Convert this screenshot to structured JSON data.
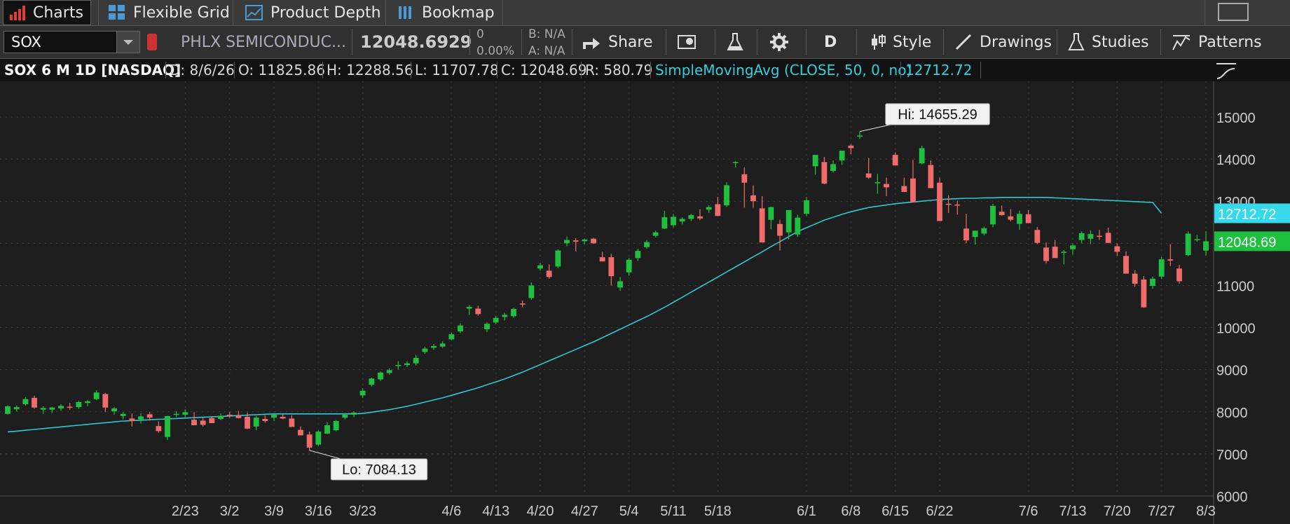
{
  "tabs": [
    {
      "label": "Charts",
      "icon": "bar-chart-icon"
    },
    {
      "label": "Flexible Grid",
      "icon": "grid-icon"
    },
    {
      "label": "Product Depth",
      "icon": "depth-chart-icon"
    },
    {
      "label": "Bookmap",
      "icon": "bookmap-icon"
    }
  ],
  "toolbar": {
    "symbol": "SOX",
    "description": "PHLX SEMICONDUC...",
    "last": "12048.6929",
    "change": "0",
    "change_pct": "0.00%",
    "bid": "B: N/A",
    "ask": "A: N/A",
    "share_label": "Share",
    "aggregation": "D",
    "style_label": "Style",
    "drawings_label": "Drawings",
    "studies_label": "Studies",
    "patterns_label": "Patterns"
  },
  "infobar": {
    "title": "SOX 6 M 1D [NASDAQ]",
    "date": "D: 8/6/26",
    "open": "O: 11825.86",
    "high": "H: 12288.56",
    "low": "L: 11707.78",
    "close": "C: 12048.69",
    "range": "R: 580.79",
    "study": "SimpleMovingAvg (CLOSE, 50, 0, no)",
    "study_value": "12712.72"
  },
  "colors": {
    "up": "#1fbf3f",
    "down": "#f06c6c",
    "sma": "#2fc7d2",
    "study_text": "#2fd0db",
    "price_tag": "#1fbf3f",
    "sma_tag": "#35d9ea",
    "background": "#1e1e1e"
  },
  "chart_data": {
    "type": "candlestick",
    "ylim": [
      6000,
      15500
    ],
    "yticks": [
      6000,
      7000,
      8000,
      9000,
      10000,
      11000,
      12000,
      13000,
      14000,
      15000
    ],
    "xtick_labels": [
      "2/23",
      "3/2",
      "3/9",
      "3/16",
      "3/23",
      "4/6",
      "4/13",
      "4/20",
      "4/27",
      "5/4",
      "5/11",
      "5/18",
      "6/1",
      "6/8",
      "6/15",
      "6/22",
      "7/6",
      "7/13",
      "7/20",
      "7/27",
      "8/3"
    ],
    "annotations": {
      "high": "Hi: 14655.29",
      "low": "Lo: 7084.13"
    },
    "price_label": "12048.69",
    "sma_label": "12712.72",
    "series": [
      {
        "name": "SOX",
        "ohlc": [
          [
            7950,
            8160,
            7930,
            8130
          ],
          [
            8060,
            8150,
            8010,
            8110
          ],
          [
            8180,
            8350,
            8150,
            8300
          ],
          [
            8330,
            8380,
            8070,
            8100
          ],
          [
            8050,
            8130,
            7950,
            8090
          ],
          [
            8050,
            8120,
            7970,
            8100
          ],
          [
            8080,
            8180,
            8020,
            8140
          ],
          [
            8120,
            8210,
            8050,
            8110
          ],
          [
            8110,
            8260,
            8070,
            8230
          ],
          [
            8210,
            8280,
            8130,
            8250
          ],
          [
            8300,
            8510,
            8280,
            8460
          ],
          [
            8420,
            8450,
            7990,
            8100
          ],
          [
            8010,
            8110,
            7930,
            8080
          ],
          [
            7900,
            7990,
            7820,
            7950
          ],
          [
            7840,
            7960,
            7650,
            7780
          ],
          [
            7820,
            7960,
            7720,
            7890
          ],
          [
            7940,
            8000,
            7790,
            7860
          ],
          [
            7660,
            7770,
            7500,
            7540
          ],
          [
            7400,
            7900,
            7330,
            7900
          ],
          [
            7930,
            8020,
            7870,
            7950
          ],
          [
            7930,
            8060,
            7870,
            7990
          ],
          [
            7810,
            7990,
            7770,
            7680
          ],
          [
            7790,
            7870,
            7650,
            7690
          ],
          [
            7850,
            7890,
            7780,
            7730
          ],
          [
            7830,
            7960,
            7800,
            7900
          ],
          [
            7930,
            7990,
            7860,
            7920
          ],
          [
            7910,
            8020,
            7840,
            7850
          ],
          [
            7880,
            7980,
            7590,
            7600
          ],
          [
            7650,
            7900,
            7560,
            7860
          ],
          [
            7830,
            7910,
            7740,
            7780
          ],
          [
            7860,
            7950,
            7780,
            7930
          ],
          [
            7880,
            7940,
            7820,
            7840
          ],
          [
            7840,
            7920,
            7640,
            7640
          ],
          [
            7570,
            7650,
            7450,
            7440
          ],
          [
            7460,
            7530,
            7084,
            7150
          ],
          [
            7220,
            7560,
            7190,
            7530
          ],
          [
            7480,
            7750,
            7470,
            7680
          ],
          [
            7560,
            7800,
            7540,
            7780
          ],
          [
            7860,
            7970,
            7820,
            7930
          ],
          [
            7930,
            8010,
            7870,
            7980
          ],
          [
            8390,
            8560,
            8330,
            8500
          ],
          [
            8640,
            8810,
            8600,
            8790
          ],
          [
            8770,
            8960,
            8730,
            8930
          ],
          [
            8920,
            9030,
            8880,
            8990
          ],
          [
            9100,
            9200,
            9000,
            9110
          ],
          [
            9110,
            9200,
            9060,
            9150
          ],
          [
            9150,
            9350,
            9100,
            9280
          ],
          [
            9420,
            9540,
            9380,
            9500
          ],
          [
            9520,
            9610,
            9470,
            9560
          ],
          [
            9550,
            9670,
            9520,
            9620
          ],
          [
            9720,
            9880,
            9700,
            9840
          ],
          [
            9910,
            10100,
            9870,
            10050
          ],
          [
            10450,
            10530,
            10300,
            10490
          ],
          [
            10450,
            10520,
            10280,
            10320
          ],
          [
            9960,
            10120,
            9890,
            10090
          ],
          [
            10120,
            10280,
            10080,
            10230
          ],
          [
            10250,
            10350,
            10170,
            10300
          ],
          [
            10270,
            10470,
            10230,
            10440
          ],
          [
            10570,
            10640,
            10480,
            10560
          ],
          [
            10700,
            11070,
            10660,
            11000
          ],
          [
            11400,
            11540,
            11350,
            11480
          ],
          [
            11350,
            11500,
            11160,
            11200
          ],
          [
            11450,
            11860,
            11410,
            11830
          ],
          [
            12000,
            12160,
            11930,
            12080
          ],
          [
            12070,
            12120,
            11810,
            12040
          ],
          [
            12050,
            12110,
            11980,
            12090
          ],
          [
            12110,
            12130,
            11990,
            12000
          ],
          [
            11670,
            11800,
            11580,
            11570
          ],
          [
            11670,
            11750,
            11000,
            11220
          ],
          [
            10950,
            11200,
            10870,
            11100
          ],
          [
            11310,
            11650,
            11230,
            11610
          ],
          [
            11650,
            11870,
            11580,
            11820
          ],
          [
            11910,
            12080,
            11870,
            12030
          ],
          [
            12180,
            12300,
            12140,
            12260
          ],
          [
            12350,
            12770,
            12340,
            12620
          ],
          [
            12430,
            12700,
            12380,
            12630
          ],
          [
            12520,
            12620,
            12450,
            12580
          ],
          [
            12580,
            12700,
            12530,
            12670
          ],
          [
            12640,
            12810,
            12550,
            12590
          ],
          [
            12800,
            12900,
            12720,
            12860
          ],
          [
            12930,
            13100,
            12880,
            12650
          ],
          [
            12900,
            13450,
            12860,
            13380
          ],
          [
            13930,
            13950,
            13800,
            13930
          ],
          [
            13640,
            13800,
            12850,
            13440
          ],
          [
            13140,
            13380,
            12850,
            13000
          ],
          [
            12830,
            13120,
            12500,
            12020
          ],
          [
            12560,
            12870,
            12330,
            12860
          ],
          [
            12460,
            12560,
            11830,
            12180
          ],
          [
            12260,
            12700,
            12090,
            12790
          ],
          [
            12210,
            12680,
            12150,
            12610
          ],
          [
            12700,
            13100,
            12650,
            13020
          ],
          [
            13830,
            13960,
            13630,
            14100
          ],
          [
            13930,
            14050,
            13400,
            13420
          ],
          [
            13720,
            13970,
            13680,
            13880
          ],
          [
            13970,
            14030,
            13860,
            14200
          ],
          [
            14320,
            14360,
            14120,
            14260
          ],
          [
            14560,
            14655,
            14480,
            14560
          ],
          [
            13660,
            14030,
            13530,
            13560
          ],
          [
            13450,
            13650,
            13180,
            13450
          ],
          [
            13410,
            13560,
            13120,
            13330
          ],
          [
            14100,
            14160,
            13870,
            13850
          ],
          [
            13360,
            13560,
            13270,
            13220
          ],
          [
            13540,
            13980,
            12970,
            12970
          ],
          [
            13900,
            14320,
            13880,
            14260
          ],
          [
            13860,
            13970,
            13310,
            13310
          ],
          [
            13440,
            13560,
            13320,
            12530
          ],
          [
            12940,
            13140,
            12720,
            12920
          ],
          [
            12920,
            13010,
            12680,
            12900
          ],
          [
            12350,
            12700,
            12000,
            12070
          ],
          [
            12150,
            12270,
            11970,
            12300
          ],
          [
            12230,
            12400,
            12190,
            12360
          ],
          [
            12450,
            12940,
            12380,
            12890
          ],
          [
            12750,
            12900,
            12660,
            12670
          ],
          [
            12640,
            12810,
            12520,
            12560
          ],
          [
            12460,
            12780,
            12320,
            12700
          ],
          [
            12690,
            12790,
            12490,
            12480
          ],
          [
            12320,
            12390,
            11980,
            12010
          ],
          [
            11900,
            12020,
            11520,
            11580
          ],
          [
            11920,
            12080,
            11780,
            11650
          ],
          [
            11790,
            11840,
            11500,
            11800
          ],
          [
            11860,
            12000,
            11730,
            11950
          ],
          [
            12080,
            12280,
            12000,
            12240
          ],
          [
            12110,
            12310,
            11980,
            12220
          ],
          [
            12180,
            12320,
            12080,
            12160
          ],
          [
            12250,
            12370,
            12010,
            12010
          ],
          [
            11930,
            12000,
            11700,
            11800
          ],
          [
            11700,
            11810,
            11560,
            11280
          ],
          [
            11280,
            11360,
            10970,
            11040
          ],
          [
            11140,
            11220,
            10470,
            10480
          ],
          [
            10990,
            11210,
            10920,
            11160
          ],
          [
            11210,
            11680,
            11150,
            11620
          ],
          [
            11620,
            11980,
            11460,
            11590
          ],
          [
            11400,
            11490,
            11040,
            11100
          ],
          [
            11720,
            12280,
            11690,
            12230
          ],
          [
            12080,
            12200,
            12040,
            12100
          ],
          [
            11825.86,
            12288.56,
            11707.78,
            12048.69
          ]
        ]
      },
      {
        "name": "SimpleMovingAvg (CLOSE, 50, 0, no)",
        "values": [
          7520,
          7540,
          7560,
          7580,
          7600,
          7620,
          7640,
          7660,
          7680,
          7700,
          7720,
          7740,
          7760,
          7780,
          7790,
          7800,
          7810,
          7820,
          7830,
          7840,
          7850,
          7860,
          7870,
          7880,
          7890,
          7900,
          7910,
          7920,
          7930,
          7940,
          7950,
          7950,
          7950,
          7950,
          7950,
          7950,
          7950,
          7950,
          7950,
          7950,
          7960,
          7990,
          8020,
          8050,
          8090,
          8130,
          8180,
          8230,
          8280,
          8330,
          8390,
          8450,
          8510,
          8570,
          8640,
          8710,
          8780,
          8860,
          8940,
          9030,
          9120,
          9210,
          9300,
          9390,
          9480,
          9570,
          9660,
          9760,
          9860,
          9960,
          10060,
          10160,
          10260,
          10370,
          10480,
          10600,
          10720,
          10840,
          10960,
          11080,
          11200,
          11320,
          11440,
          11560,
          11680,
          11800,
          11920,
          12040,
          12160,
          12280,
          12370,
          12460,
          12550,
          12620,
          12690,
          12750,
          12800,
          12850,
          12880,
          12910,
          12940,
          12960,
          12980,
          13000,
          13020,
          13040,
          13050,
          13060,
          13070,
          13070,
          13080,
          13080,
          13090,
          13090,
          13090,
          13090,
          13090,
          13090,
          13080,
          13070,
          13060,
          13050,
          13040,
          13030,
          13020,
          13010,
          13000,
          12990,
          12980,
          12970,
          12712.72
        ]
      }
    ]
  }
}
